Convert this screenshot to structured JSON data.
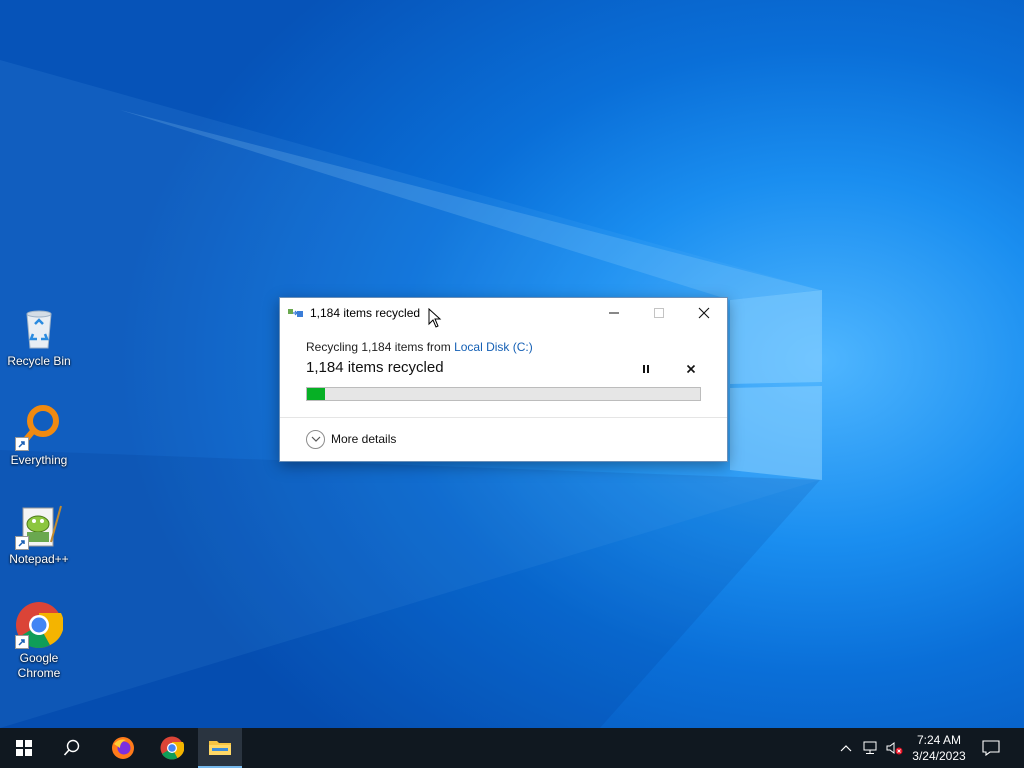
{
  "desktop": {
    "icons": [
      {
        "label": "Recycle Bin",
        "icon": "recycle-bin-icon"
      },
      {
        "label": "Everything",
        "icon": "everything-icon"
      },
      {
        "label": "Notepad++",
        "icon": "notepad-plus-plus-icon"
      },
      {
        "label": "Google Chrome",
        "icon": "google-chrome-icon"
      }
    ]
  },
  "dialog": {
    "title": "1,184 items recycled",
    "status_prefix": "Recycling 1,184 items from ",
    "location_link": "Local Disk (C:)",
    "progress_heading": "1,184 items recycled",
    "progress_fraction": 0.045,
    "more_details": "More details",
    "colors": {
      "progress": "#06b025",
      "link": "#1560b5"
    }
  },
  "taskbar": {
    "time": "7:24 AM",
    "date": "3/24/2023",
    "apps": [
      "start-icon",
      "search-icon",
      "firefox-icon",
      "chrome-icon",
      "file-explorer-icon"
    ]
  }
}
